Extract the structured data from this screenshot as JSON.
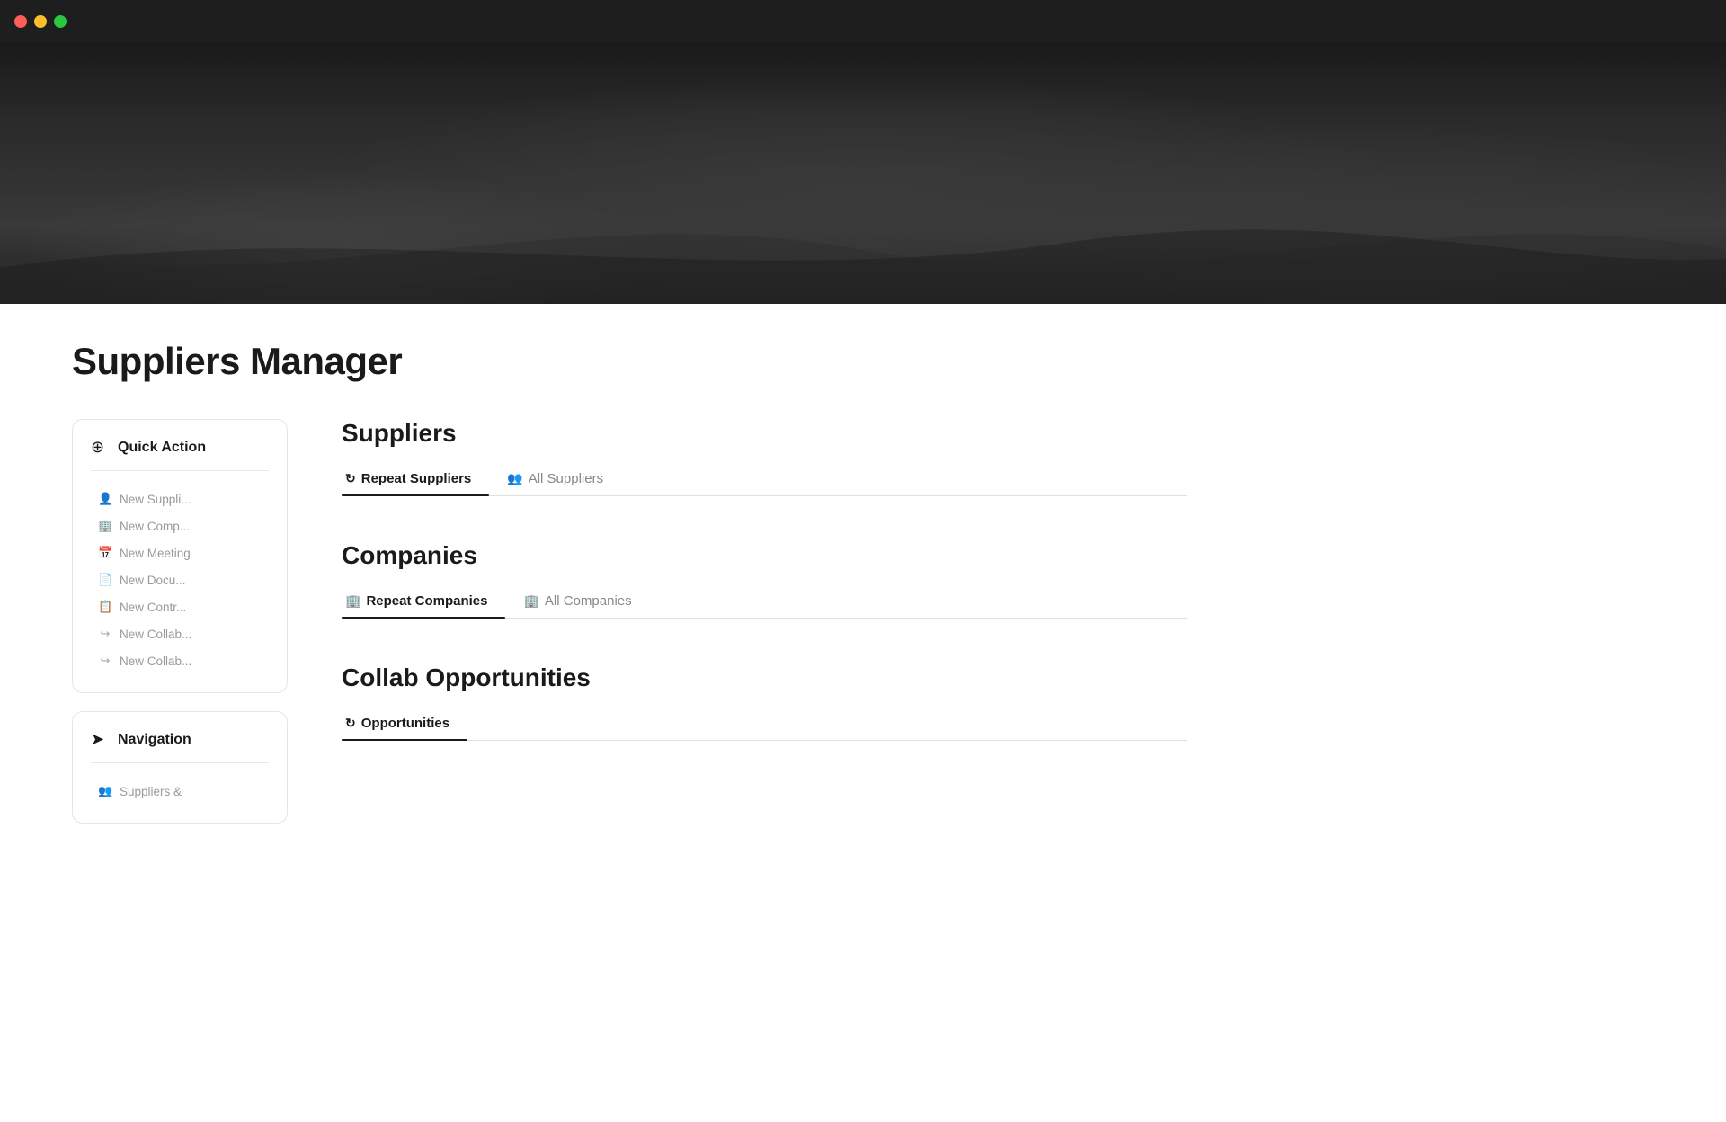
{
  "titlebar": {
    "traffic_lights": [
      "red",
      "yellow",
      "green"
    ]
  },
  "page": {
    "title": "Suppliers Manager"
  },
  "quick_action": {
    "header_label": "Quick Action",
    "header_icon": "plus-circle",
    "items": [
      {
        "label": "New Suppli...",
        "icon": "person"
      },
      {
        "label": "New Comp...",
        "icon": "building"
      },
      {
        "label": "New Meeting",
        "icon": "calendar"
      },
      {
        "label": "New Docu...",
        "icon": "document"
      },
      {
        "label": "New Contr...",
        "icon": "document-lines"
      },
      {
        "label": "New Collab...",
        "icon": "arrow-share"
      },
      {
        "label": "New Collab...",
        "icon": "arrow-share"
      }
    ]
  },
  "navigation": {
    "header_label": "Navigation",
    "header_icon": "location-arrow",
    "items": [
      {
        "label": "Suppliers &",
        "icon": "persons"
      }
    ]
  },
  "suppliers_section": {
    "title": "Suppliers",
    "tabs": [
      {
        "label": "Repeat Suppliers",
        "icon": "repeat",
        "active": true
      },
      {
        "label": "All Suppliers",
        "icon": "persons",
        "active": false
      }
    ]
  },
  "companies_section": {
    "title": "Companies",
    "tabs": [
      {
        "label": "Repeat Companies",
        "icon": "building",
        "active": true
      },
      {
        "label": "All Companies",
        "icon": "building",
        "active": false
      }
    ]
  },
  "collab_section": {
    "title": "Collab Opportunities",
    "tabs": [
      {
        "label": "Opportunities",
        "icon": "repeat",
        "active": true
      }
    ]
  }
}
